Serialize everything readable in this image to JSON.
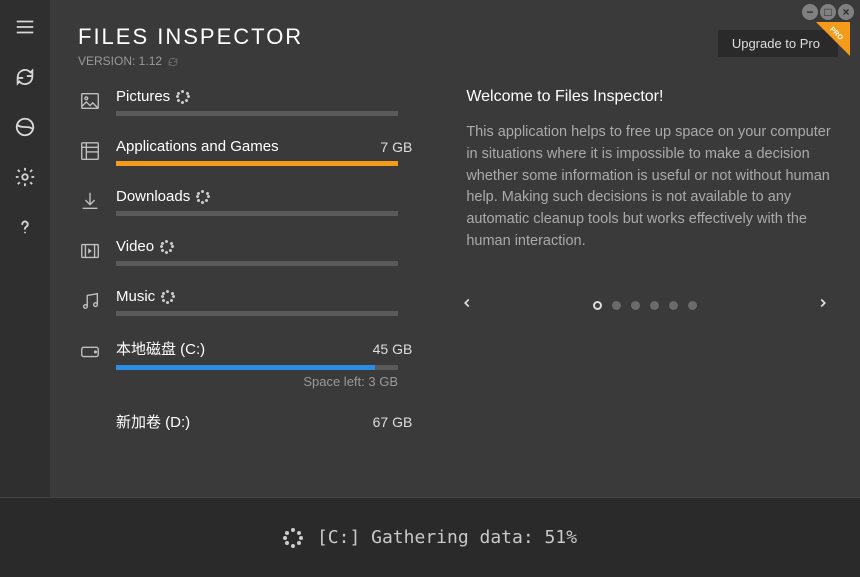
{
  "app": {
    "title": "FILES INSPECTOR",
    "version_label": "VERSION: 1.12",
    "upgrade_label": "Upgrade to Pro",
    "pro_label": "PRO"
  },
  "categories": [
    {
      "label": "Pictures",
      "loading": true,
      "size": "",
      "fill": 0,
      "color": "#5a5a5a"
    },
    {
      "label": "Applications and Games",
      "loading": false,
      "size": "7 GB",
      "fill": 100,
      "color": "#f59b1c"
    },
    {
      "label": "Downloads",
      "loading": true,
      "size": "",
      "fill": 0,
      "color": "#5a5a5a"
    },
    {
      "label": "Video",
      "loading": true,
      "size": "",
      "fill": 0,
      "color": "#5a5a5a"
    },
    {
      "label": "Music",
      "loading": true,
      "size": "",
      "fill": 0,
      "color": "#5a5a5a"
    },
    {
      "label": "本地磁盘 (C:)",
      "loading": false,
      "size": "45 GB",
      "fill": 92,
      "color": "#2b8ee6",
      "sub": "Space left: 3 GB"
    },
    {
      "label": "新加卷 (D:)",
      "loading": false,
      "size": "67 GB",
      "fill": 0
    }
  ],
  "welcome": {
    "title": "Welcome to Files Inspector!",
    "text": "This application helps to free up space on your computer in situations where it is impossible to make a decision whether some information is useful or not without human help. Making such decisions is not available to any automatic cleanup tools but works effectively with the human interaction."
  },
  "carousel": {
    "count": 6,
    "active": 0
  },
  "status": "[C:] Gathering data: 51%"
}
